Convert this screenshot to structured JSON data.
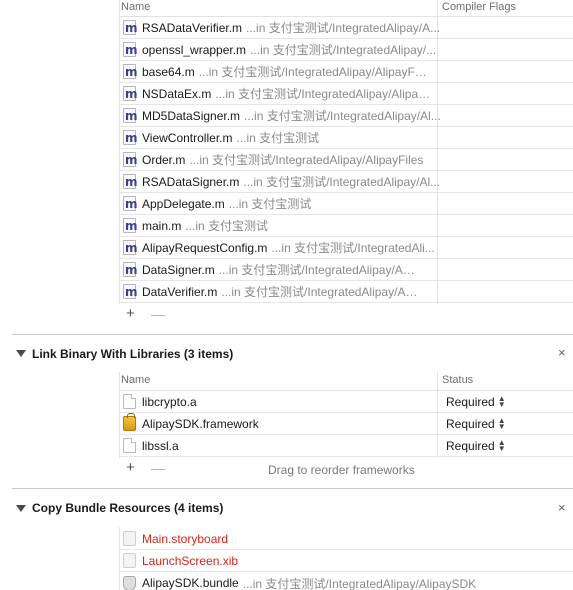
{
  "compile_sources": {
    "header_name": "Name",
    "header_flags": "Compiler Flags",
    "files": [
      {
        "name": "RSADataVerifier.m",
        "path": "...in 支付宝测试/IntegratedAlipay/A..."
      },
      {
        "name": "openssl_wrapper.m",
        "path": "...in 支付宝测试/IntegratedAlipay/..."
      },
      {
        "name": "base64.m",
        "path": "...in 支付宝测试/IntegratedAlipay/AlipayFile..."
      },
      {
        "name": "NSDataEx.m",
        "path": "...in 支付宝测试/IntegratedAlipay/AlipayF..."
      },
      {
        "name": "MD5DataSigner.m",
        "path": "...in 支付宝测试/IntegratedAlipay/Al..."
      },
      {
        "name": "ViewController.m",
        "path": "...in 支付宝测试"
      },
      {
        "name": "Order.m",
        "path": "...in 支付宝测试/IntegratedAlipay/AlipayFiles"
      },
      {
        "name": "RSADataSigner.m",
        "path": "...in 支付宝测试/IntegratedAlipay/Al..."
      },
      {
        "name": "AppDelegate.m",
        "path": "...in 支付宝测试"
      },
      {
        "name": "main.m",
        "path": "...in 支付宝测试"
      },
      {
        "name": "AlipayRequestConfig.m",
        "path": "...in 支付宝测试/IntegratedAli..."
      },
      {
        "name": "DataSigner.m",
        "path": "...in 支付宝测试/IntegratedAlipay/Alipay..."
      },
      {
        "name": "DataVerifier.m",
        "path": "...in 支付宝测试/IntegratedAlipay/Alipay..."
      }
    ],
    "plus": "+",
    "minus": "—"
  },
  "link_binary": {
    "title": "Link Binary With Libraries (3 items)",
    "header_name": "Name",
    "header_status": "Status",
    "libraries": [
      {
        "name": "libcrypto.a",
        "status": "Required",
        "icon": "document-icon"
      },
      {
        "name": "AlipaySDK.framework",
        "status": "Required",
        "icon": "framework-toolbox-icon"
      },
      {
        "name": "libssl.a",
        "status": "Required",
        "icon": "document-icon"
      }
    ],
    "plus": "+",
    "minus": "—",
    "drag_hint": "Drag to reorder frameworks",
    "close": "×"
  },
  "copy_bundle": {
    "title": "Copy Bundle Resources (4 items)",
    "resources": [
      {
        "name": "Main.storyboard",
        "missing": true
      },
      {
        "name": "LaunchScreen.xib",
        "missing": true
      },
      {
        "name": "AlipaySDK.bundle",
        "path": "...in 支付宝测试/IntegratedAlipay/AlipaySDK",
        "missing": false
      }
    ],
    "close": "×"
  },
  "colors": {
    "missing_file": "#d7261c",
    "path_text": "#8a8a8a"
  }
}
